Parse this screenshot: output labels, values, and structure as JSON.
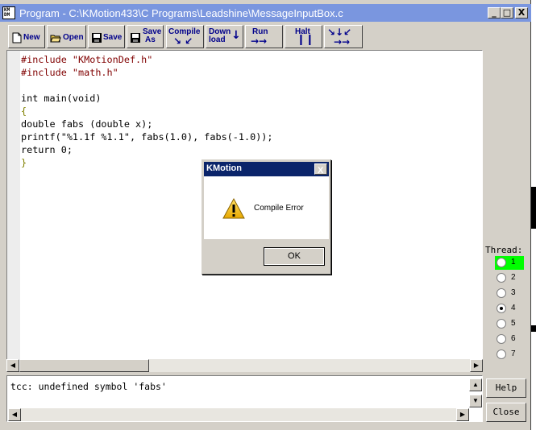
{
  "window": {
    "title": "Program - C:\\KMotion433\\C Programs\\Leadshine\\MessageInputBox.c",
    "app_icon": "kmotion-app-icon",
    "caption_buttons": {
      "minimize": "_",
      "maximize": "□",
      "close": "X"
    }
  },
  "toolbar": {
    "new": "New",
    "open": "Open",
    "save": "Save",
    "save_as_1": "Save",
    "save_as_2": "As",
    "compile": "Compile",
    "download_1": "Down",
    "download_2": "load",
    "run": "Run",
    "halt": "Halt"
  },
  "editor": {
    "lines": [
      "#include \"KMotionDef.h\"",
      "#include \"math.h\"",
      "",
      "int main(void)",
      "{",
      "double fabs (double x);",
      "printf(\"%1.1f %1.1\", fabs(1.0), fabs(-1.0));",
      "return 0;",
      "}"
    ]
  },
  "output": {
    "text": "tcc: undefined symbol 'fabs'"
  },
  "threads": {
    "label": "Thread:",
    "items": [
      {
        "num": "1",
        "active": true,
        "checked": false
      },
      {
        "num": "2",
        "active": false,
        "checked": false
      },
      {
        "num": "3",
        "active": false,
        "checked": false
      },
      {
        "num": "4",
        "active": false,
        "checked": true
      },
      {
        "num": "5",
        "active": false,
        "checked": false
      },
      {
        "num": "6",
        "active": false,
        "checked": false
      },
      {
        "num": "7",
        "active": false,
        "checked": false
      }
    ]
  },
  "buttons": {
    "help": "Help",
    "close": "Close"
  },
  "dialog": {
    "title": "KMotion",
    "close": "X",
    "message": "Compile Error",
    "ok": "OK",
    "icon": "warning-icon"
  },
  "colors": {
    "titlebar": "#7a96df",
    "dialog_titlebar": "#0a246a",
    "active_thread": "#00ff00",
    "toolbar_text": "#00008b"
  }
}
